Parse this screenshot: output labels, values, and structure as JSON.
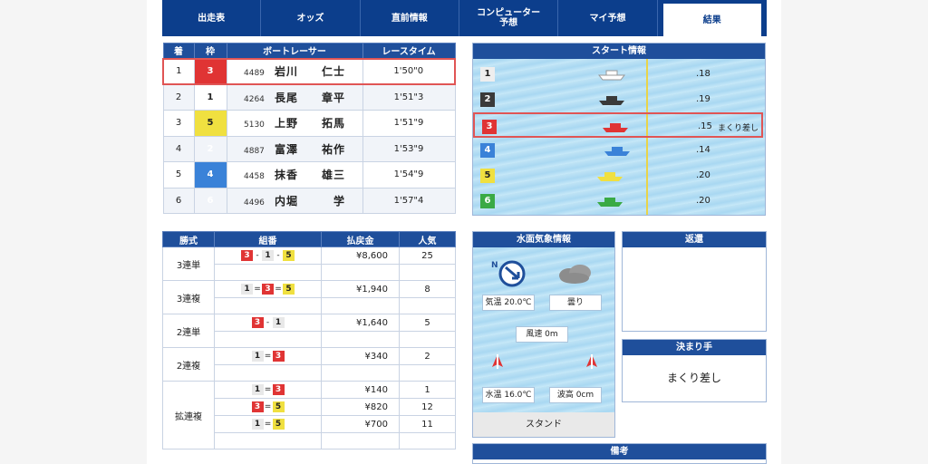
{
  "nav": {
    "tabs": [
      {
        "label": "出走表",
        "active": false
      },
      {
        "label": "オッズ",
        "active": false
      },
      {
        "label": "直前情報",
        "active": false
      },
      {
        "label": "コンピューター\n予想",
        "active": false
      },
      {
        "label": "マイ予想",
        "active": false
      },
      {
        "label": "結果",
        "active": true
      }
    ]
  },
  "result": {
    "headers": [
      "着",
      "枠",
      "ボートレーサー",
      "レースタイム"
    ],
    "rows": [
      {
        "rank": "1",
        "frame": "3",
        "reg": "4489",
        "name": "岩川　　仁士",
        "time": "1'50\"0"
      },
      {
        "rank": "2",
        "frame": "1",
        "reg": "4264",
        "name": "長尾　　章平",
        "time": "1'51\"3"
      },
      {
        "rank": "3",
        "frame": "5",
        "reg": "5130",
        "name": "上野　　拓馬",
        "time": "1'51\"9"
      },
      {
        "rank": "4",
        "frame": "2",
        "reg": "4887",
        "name": "富澤　　祐作",
        "time": "1'53\"9"
      },
      {
        "rank": "5",
        "frame": "4",
        "reg": "4458",
        "name": "抹香　　雄三",
        "time": "1'54\"9"
      },
      {
        "rank": "6",
        "frame": "6",
        "reg": "4496",
        "name": "内堀　　　学",
        "time": "1'57\"4"
      }
    ]
  },
  "start": {
    "title": "スタート情報",
    "rows": [
      {
        "lane": "1",
        "st": ".18",
        "kimarite": ""
      },
      {
        "lane": "2",
        "st": ".19",
        "kimarite": ""
      },
      {
        "lane": "3",
        "st": ".15",
        "kimarite": "まくり差し"
      },
      {
        "lane": "4",
        "st": ".14",
        "kimarite": ""
      },
      {
        "lane": "5",
        "st": ".20",
        "kimarite": ""
      },
      {
        "lane": "6",
        "st": ".20",
        "kimarite": ""
      }
    ]
  },
  "payout": {
    "headers": [
      "勝式",
      "組番",
      "払戻金",
      "人気"
    ],
    "groups": [
      {
        "kind": "3連単",
        "rows": [
          {
            "combo": [
              "3",
              "-",
              "1",
              "-",
              "5"
            ],
            "amount": "¥8,600",
            "pop": "25"
          }
        ],
        "blank": 1
      },
      {
        "kind": "3連複",
        "rows": [
          {
            "combo": [
              "1",
              "=",
              "3",
              "=",
              "5"
            ],
            "amount": "¥1,940",
            "pop": "8"
          }
        ],
        "blank": 1
      },
      {
        "kind": "2連単",
        "rows": [
          {
            "combo": [
              "3",
              "-",
              "1"
            ],
            "amount": "¥1,640",
            "pop": "5"
          }
        ],
        "blank": 1
      },
      {
        "kind": "2連複",
        "rows": [
          {
            "combo": [
              "1",
              "=",
              "3"
            ],
            "amount": "¥340",
            "pop": "2"
          }
        ],
        "blank": 1
      },
      {
        "kind": "拡連複",
        "rows": [
          {
            "combo": [
              "1",
              "=",
              "3"
            ],
            "amount": "¥140",
            "pop": "1"
          },
          {
            "combo": [
              "3",
              "=",
              "5"
            ],
            "amount": "¥820",
            "pop": "12"
          },
          {
            "combo": [
              "1",
              "=",
              "5"
            ],
            "amount": "¥700",
            "pop": "11"
          }
        ],
        "blank": 1
      }
    ]
  },
  "weather": {
    "title": "水面気象情報",
    "wind_dir_label": "N",
    "temp": "気温 20.0℃",
    "weather": "曇り",
    "wind": "風速 0m",
    "water_temp": "水温 16.0℃",
    "wave": "波高 0cm",
    "stand": "スタンド"
  },
  "refund": {
    "title": "返還",
    "body": ""
  },
  "kimarite": {
    "title": "決まり手",
    "body": "まくり差し"
  },
  "remarks": {
    "title": "備考"
  }
}
